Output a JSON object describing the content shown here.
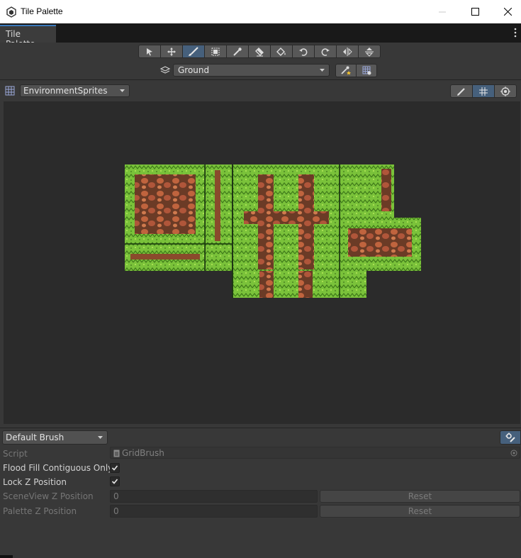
{
  "window": {
    "title": "Tile Palette",
    "controls": [
      "minimize-icon",
      "maximize-icon",
      "close-icon"
    ]
  },
  "tab": {
    "label": "Tile Palette"
  },
  "toolbar": {
    "tools": [
      {
        "name": "select-tool",
        "icon": "arrow-pointer-icon",
        "active": false
      },
      {
        "name": "move-tool",
        "icon": "move-arrows-icon",
        "active": false
      },
      {
        "name": "paint-tool",
        "icon": "paintbrush-icon",
        "active": true
      },
      {
        "name": "box-fill-tool",
        "icon": "box-fill-icon",
        "active": false
      },
      {
        "name": "picker-tool",
        "icon": "eyedropper-icon",
        "active": false
      },
      {
        "name": "erase-tool",
        "icon": "eraser-icon",
        "active": false
      },
      {
        "name": "flood-fill-tool",
        "icon": "paint-bucket-icon",
        "active": false
      },
      {
        "name": "rotate-ccw-tool",
        "icon": "rotate-ccw-icon",
        "active": false
      },
      {
        "name": "rotate-cw-tool",
        "icon": "rotate-cw-icon",
        "active": false
      },
      {
        "name": "flip-x-tool",
        "icon": "flip-horizontal-icon",
        "active": false
      },
      {
        "name": "flip-y-tool",
        "icon": "flip-vertical-icon",
        "active": false
      }
    ],
    "active_tilemap": "Ground"
  },
  "palette": {
    "selected": "EnvironmentSprites"
  },
  "brush": {
    "selected": "Default Brush",
    "fields": {
      "script_label": "Script",
      "script_value": "GridBrush",
      "flood_fill_label": "Flood Fill Contiguous Only",
      "flood_fill_checked": true,
      "lock_z_label": "Lock Z Position",
      "lock_z_checked": true,
      "sceneview_z_label": "SceneView Z Position",
      "sceneview_z_value": "0",
      "palette_z_label": "Palette Z Position",
      "palette_z_value": "0",
      "reset_label": "Reset"
    }
  },
  "colors": {
    "accent": "#46607c",
    "tab_highlight": "#3a79bb",
    "grass": "#7ac23a",
    "dirt": "#b0563a"
  }
}
